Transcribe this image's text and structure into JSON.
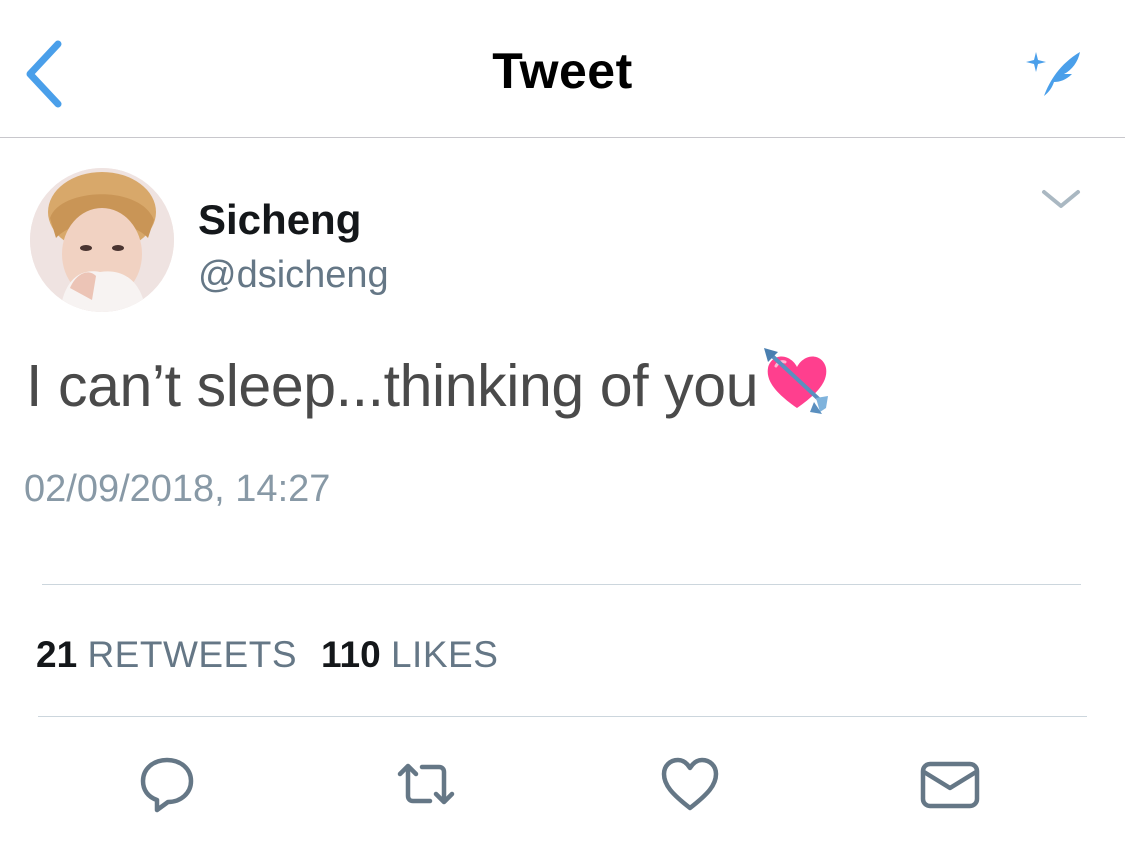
{
  "nav": {
    "title": "Tweet",
    "back_icon": "chevron-left-icon",
    "compose_icon": "compose-feather-icon",
    "accent_color": "#4a9fea"
  },
  "tweet": {
    "author": {
      "display_name": "Sicheng",
      "handle": "@dsicheng",
      "avatar_icon": "avatar-photo"
    },
    "text": "I can’t sleep...thinking of you",
    "emoji": "heart-with-arrow-emoji",
    "timestamp": "02/09/2018, 14:27"
  },
  "stats": {
    "retweets_count": "21",
    "retweets_label": "RETWEETS",
    "likes_count": "110",
    "likes_label": "LIKES"
  },
  "actions": [
    {
      "name": "reply",
      "icon": "reply-icon"
    },
    {
      "name": "retweet",
      "icon": "retweet-icon"
    },
    {
      "name": "like",
      "icon": "heart-icon"
    },
    {
      "name": "direct-message",
      "icon": "envelope-icon"
    }
  ],
  "colors": {
    "text_primary": "#14171a",
    "text_secondary": "#657786",
    "icon_gray": "#657786",
    "divider": "#ccd6dd"
  }
}
